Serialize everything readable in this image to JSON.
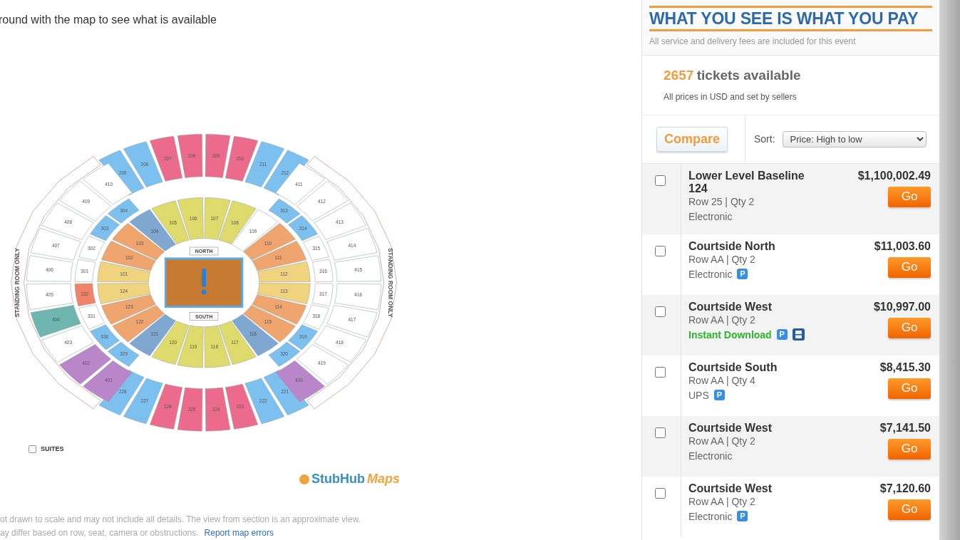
{
  "intro": "round with the map to see what is available",
  "map": {
    "rings": [
      {
        "sections": [
          {
            "label": "101",
            "color": "#f1d27e"
          },
          {
            "label": "102",
            "color": "#f0a46e"
          },
          {
            "label": "103",
            "color": "#f0a46e"
          },
          {
            "label": "104",
            "color": "#7fa7cf"
          },
          {
            "label": "105",
            "color": "#dedb6c"
          },
          {
            "label": "106",
            "color": "#dedb6c"
          },
          {
            "label": "107",
            "color": "#dedb6c"
          },
          {
            "label": "108",
            "color": "#dedb6c"
          },
          {
            "label": "109",
            "color": "#ffffff"
          },
          {
            "label": "110",
            "color": "#f0a46e"
          },
          {
            "label": "111",
            "color": "#f0a46e"
          },
          {
            "label": "112",
            "color": "#f1d27e"
          },
          {
            "label": "113",
            "color": "#f1d27e"
          },
          {
            "label": "114",
            "color": "#f0a46e"
          },
          {
            "label": "115",
            "color": "#f0a46e"
          },
          {
            "label": "116",
            "color": "#7fa7cf"
          },
          {
            "label": "117",
            "color": "#dedb6c"
          },
          {
            "label": "118",
            "color": "#dedb6c"
          },
          {
            "label": "119",
            "color": "#dedb6c"
          },
          {
            "label": "120",
            "color": "#dedb6c"
          },
          {
            "label": "121",
            "color": "#7fa7cf"
          },
          {
            "label": "122",
            "color": "#f0a46e"
          },
          {
            "label": "123",
            "color": "#f0a46e"
          },
          {
            "label": "124",
            "color": "#f1d27e"
          }
        ]
      },
      {
        "sections": [
          {
            "label": "329",
            "color": "#7cc0f0"
          },
          {
            "label": "330",
            "color": "#7cc0f0"
          },
          {
            "label": "331",
            "color": "#ffffff"
          },
          {
            "label": "332",
            "color": "#f2836b"
          },
          {
            "label": "301",
            "color": "#ffffff"
          },
          {
            "label": "302",
            "color": "#ffffff"
          },
          {
            "label": "303",
            "color": "#7cc0f0"
          },
          {
            "label": "304",
            "color": "#7cc0f0"
          }
        ]
      },
      {
        "sections": [
          {
            "label": "313",
            "color": "#7cc0f0"
          },
          {
            "label": "314",
            "color": "#7cc0f0"
          },
          {
            "label": "315",
            "color": "#ffffff"
          },
          {
            "label": "316",
            "color": "#ffffff"
          },
          {
            "label": "317",
            "color": "#ffffff"
          },
          {
            "label": "318",
            "color": "#ffffff"
          },
          {
            "label": "319",
            "color": "#7cc0f0"
          },
          {
            "label": "320",
            "color": "#7cc0f0"
          }
        ]
      },
      {
        "sections": [
          {
            "label": "205",
            "color": "#7cc0f0"
          },
          {
            "label": "206",
            "color": "#7cc0f0"
          },
          {
            "label": "207",
            "color": "#ec6b8c"
          },
          {
            "label": "208",
            "color": "#ec6b8c"
          },
          {
            "label": "209",
            "color": "#ec6b8c"
          },
          {
            "label": "210",
            "color": "#ec6b8c"
          },
          {
            "label": "211",
            "color": "#7cc0f0"
          },
          {
            "label": "212",
            "color": "#7cc0f0"
          }
        ]
      },
      {
        "sections": [
          {
            "label": "221",
            "color": "#7cc0f0"
          },
          {
            "label": "222",
            "color": "#7cc0f0"
          },
          {
            "label": "223",
            "color": "#ec6b8c"
          },
          {
            "label": "224",
            "color": "#ec6b8c"
          },
          {
            "label": "225",
            "color": "#ec6b8c"
          },
          {
            "label": "226",
            "color": "#ec6b8c"
          },
          {
            "label": "227",
            "color": "#7cc0f0"
          },
          {
            "label": "228",
            "color": "#7cc0f0"
          }
        ]
      },
      {
        "sections": [
          {
            "label": "401",
            "color": "#b987c9"
          },
          {
            "label": "402",
            "color": "#b987c9"
          },
          {
            "label": "403",
            "color": "#ffffff"
          },
          {
            "label": "404",
            "color": "#6fb5b0"
          },
          {
            "label": "405",
            "color": "#ffffff"
          },
          {
            "label": "406",
            "color": "#ffffff"
          },
          {
            "label": "407",
            "color": "#ffffff"
          },
          {
            "label": "408",
            "color": "#ffffff"
          },
          {
            "label": "409",
            "color": "#ffffff"
          },
          {
            "label": "410",
            "color": "#ffffff"
          }
        ]
      },
      {
        "sections": [
          {
            "label": "411",
            "color": "#ffffff"
          },
          {
            "label": "412",
            "color": "#ffffff"
          },
          {
            "label": "413",
            "color": "#ffffff"
          },
          {
            "label": "414",
            "color": "#ffffff"
          },
          {
            "label": "415",
            "color": "#ffffff"
          },
          {
            "label": "416",
            "color": "#ffffff"
          },
          {
            "label": "417",
            "color": "#ffffff"
          },
          {
            "label": "418",
            "color": "#ffffff"
          },
          {
            "label": "419",
            "color": "#ffffff"
          },
          {
            "label": "420",
            "color": "#b987c9"
          }
        ]
      }
    ],
    "court_labels": [
      "NORTH",
      "SOUTH"
    ],
    "standing_labels": [
      "STANDING ROOM ONLY",
      "STANDING ROOM ONLY"
    ],
    "suites": {
      "label": "SUITES",
      "checked": false
    }
  },
  "logo": {
    "text_1": "StubHub",
    "text_2": "Maps"
  },
  "disclaimer": {
    "line_1": "ot drawn to scale and may not include all details. The view from section is an approximate view.",
    "line_2": "ay differ based on row, seat, camera or obstructions.",
    "link": "Report map errors"
  },
  "sidebar": {
    "title": "WHAT YOU SEE IS WHAT YOU PAY",
    "subtitle": "All service and delivery fees are included for this event",
    "count": "2657",
    "count_label": "tickets available",
    "note": "All prices in USD and set by sellers",
    "compare": "Compare",
    "sort_label": "Sort:",
    "sort_value": "Price: High to low"
  },
  "listings": [
    {
      "name": "Lower Level Baseline 124",
      "detail": "Row 25 | Qty 2",
      "delivery": "Electronic",
      "instant": false,
      "price": "$1,100,002.49",
      "go": "Go",
      "checked": false
    },
    {
      "name": "Courtside North",
      "detail": "Row AA | Qty 2",
      "delivery": "Electronic",
      "instant": false,
      "badges": [
        {
          "kind": "letter",
          "label": "P"
        }
      ],
      "price": "$11,003.60",
      "go": "Go",
      "checked": false
    },
    {
      "name": "Courtside West",
      "detail": "Row AA | Qty 2",
      "delivery": "Instant Download",
      "instant": true,
      "badges": [
        {
          "kind": "letter",
          "label": "P"
        },
        {
          "kind": "card"
        }
      ],
      "price": "$10,997.00",
      "go": "Go",
      "checked": false
    },
    {
      "name": "Courtside South",
      "detail": "Row AA | Qty 4",
      "delivery": "UPS",
      "instant": false,
      "badges": [
        {
          "kind": "letter",
          "label": "P"
        }
      ],
      "price": "$8,415.30",
      "go": "Go",
      "checked": false
    },
    {
      "name": "Courtside West",
      "detail": "Row AA | Qty 2",
      "delivery": "Electronic",
      "instant": false,
      "price": "$7,141.50",
      "go": "Go",
      "checked": false
    },
    {
      "name": "Courtside West",
      "detail": "Row AA | Qty 2",
      "delivery": "Electronic",
      "instant": false,
      "badges": [
        {
          "kind": "letter",
          "label": "P"
        }
      ],
      "price": "$7,120.60",
      "go": "Go",
      "checked": false
    }
  ]
}
